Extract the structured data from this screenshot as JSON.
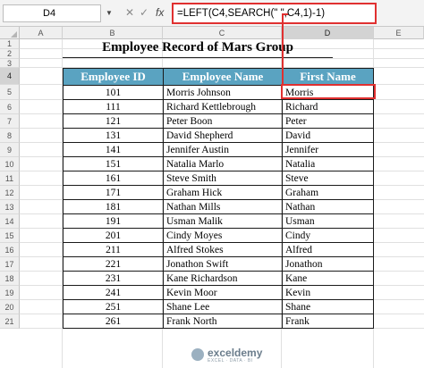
{
  "formula_bar": {
    "name_box": "D4",
    "cancel_glyph": "✕",
    "enter_glyph": "✓",
    "fx_glyph": "fx",
    "formula": "=LEFT(C4,SEARCH(\" \",C4,1)-1)"
  },
  "columns": [
    "A",
    "B",
    "C",
    "D",
    "E"
  ],
  "rows": [
    "1",
    "2",
    "3",
    "4",
    "5",
    "6",
    "7",
    "8",
    "9",
    "10",
    "11",
    "12",
    "13",
    "14",
    "15",
    "16",
    "17",
    "18",
    "19",
    "20",
    "21"
  ],
  "selected_cell": "D4",
  "sheet_title": "Employee Record of Mars Group",
  "table": {
    "headers": [
      "Employee ID",
      "Employee Name",
      "First Name"
    ],
    "rows": [
      [
        "101",
        "Morris Johnson",
        "Morris"
      ],
      [
        "111",
        "Richard Kettlebrough",
        "Richard"
      ],
      [
        "121",
        "Peter Boon",
        "Peter"
      ],
      [
        "131",
        "David Shepherd",
        "David"
      ],
      [
        "141",
        "Jennifer Austin",
        "Jennifer"
      ],
      [
        "151",
        "Natalia Marlo",
        "Natalia"
      ],
      [
        "161",
        "Steve Smith",
        "Steve"
      ],
      [
        "171",
        "Graham Hick",
        "Graham"
      ],
      [
        "181",
        "Nathan Mills",
        "Nathan"
      ],
      [
        "191",
        "Usman Malik",
        "Usman"
      ],
      [
        "201",
        "Cindy Moyes",
        "Cindy"
      ],
      [
        "211",
        "Alfred Stokes",
        "Alfred"
      ],
      [
        "221",
        "Jonathon Swift",
        "Jonathon"
      ],
      [
        "231",
        "Kane Richardson",
        "Kane"
      ],
      [
        "241",
        "Kevin Moor",
        "Kevin"
      ],
      [
        "251",
        "Shane Lee",
        "Shane"
      ],
      [
        "261",
        "Frank North",
        "Frank"
      ]
    ]
  },
  "watermark": {
    "brand": "exceldemy",
    "tagline": "EXCEL · DATA · BI"
  },
  "colors": {
    "header_fill": "#5aa3c1",
    "highlight": "#e03030"
  }
}
